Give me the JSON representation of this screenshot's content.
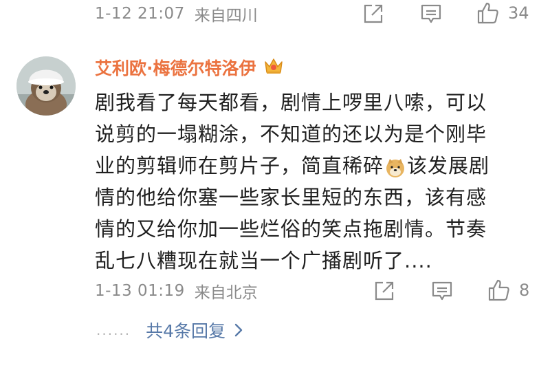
{
  "prev_comment": {
    "time": "1-12 21:07",
    "location": "来自四川",
    "like_count": "34"
  },
  "comment": {
    "username": "艾利欧·梅德尔特洛伊",
    "lines": [
      "剧我看了每天都看，剧情上啰里八嗦，可以",
      "说剪的一塌糊涂，不知道的还以为是个刚毕",
      "业的剪辑师在剪片子，简直稀碎",
      "该发展剧",
      "情的他给你塞一些家长里短的东西，该有感",
      "情的又给你加一些烂俗的笑点拖剧情。节奏",
      "乱七八糟现在就当一个广播剧听了...."
    ],
    "time": "1-13 01:19",
    "location": "来自北京",
    "like_count": "8"
  },
  "replies": {
    "dots": "......",
    "label": "共4条回复"
  },
  "icons": {
    "share": "share-icon",
    "comment": "comment-icon",
    "like": "thumbs-up-icon",
    "badge": "vip-crown-icon",
    "emoji": "doge-emoji-icon",
    "chevron": "chevron-right-icon"
  },
  "colors": {
    "username": "#eb7340",
    "reply_link": "#5779a8",
    "meta": "#8a8a8a"
  }
}
